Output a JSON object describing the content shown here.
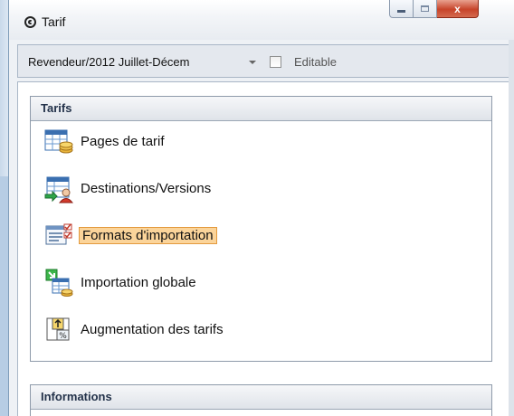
{
  "window": {
    "title": "Tarif",
    "icon": "app-circle-icon"
  },
  "caption_buttons": {
    "minimize": "minimize-icon",
    "maximize": "maximize-icon",
    "close_glyph": "x"
  },
  "toolbar": {
    "combo_value": "Revendeur/2012 Juillet-Décem",
    "editable_label": "Editable",
    "editable_checked": false
  },
  "tarifs_group": {
    "header": "Tarifs",
    "items": [
      {
        "label": "Pages de tarif",
        "icon": "price-pages-icon"
      },
      {
        "label": "Destinations/Versions",
        "icon": "destinations-versions-icon"
      },
      {
        "label": "Formats d'importation",
        "icon": "import-formats-icon",
        "selected": true
      },
      {
        "label": "Importation globale",
        "icon": "global-import-icon"
      },
      {
        "label": "Augmentation des tarifs",
        "icon": "price-increase-icon"
      }
    ]
  },
  "info_group": {
    "header": "Informations"
  }
}
